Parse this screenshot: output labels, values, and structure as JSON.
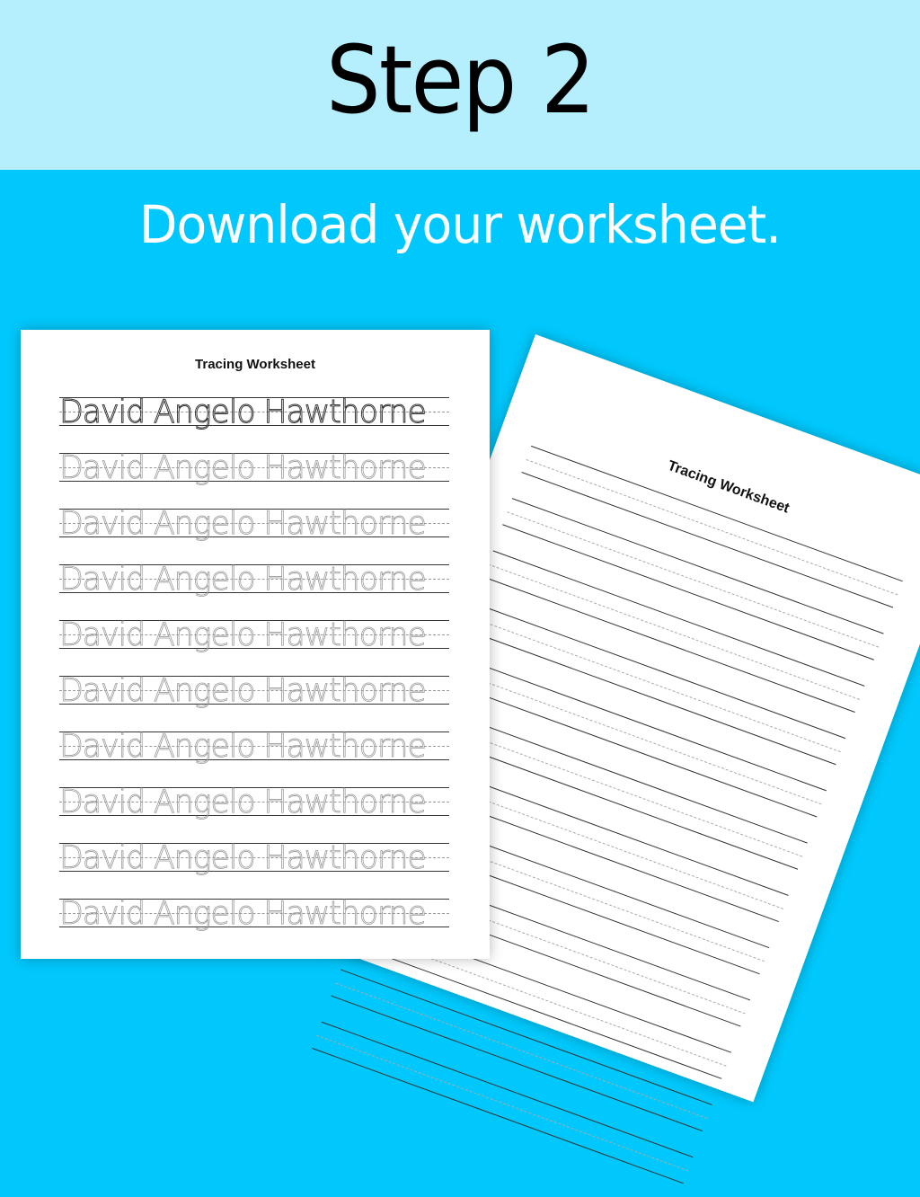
{
  "header": {
    "step_title": "Step 2",
    "subtitle": "Download your worksheet."
  },
  "colors": {
    "top_band": "#b5effd",
    "background": "#00c8fc",
    "title_text": "#000000",
    "subtitle_text": "#ffffff"
  },
  "worksheet_front": {
    "title": "Tracing Worksheet",
    "rows": [
      {
        "text": "David Angelo Hawthorne",
        "style": "solid"
      },
      {
        "text": "David Angelo Hawthorne",
        "style": "dotted"
      },
      {
        "text": "David Angelo Hawthorne",
        "style": "dotted"
      },
      {
        "text": "David Angelo Hawthorne",
        "style": "dotted"
      },
      {
        "text": "David Angelo Hawthorne",
        "style": "dotted"
      },
      {
        "text": "David Angelo Hawthorne",
        "style": "dotted"
      },
      {
        "text": "David Angelo Hawthorne",
        "style": "dotted"
      },
      {
        "text": "David Angelo Hawthorne",
        "style": "dotted"
      },
      {
        "text": "David Angelo Hawthorne",
        "style": "dotted"
      },
      {
        "text": "David Angelo Hawthorne",
        "style": "dotted"
      }
    ]
  },
  "worksheet_back": {
    "title": "Tracing Worksheet",
    "blank_row_count": 12
  }
}
